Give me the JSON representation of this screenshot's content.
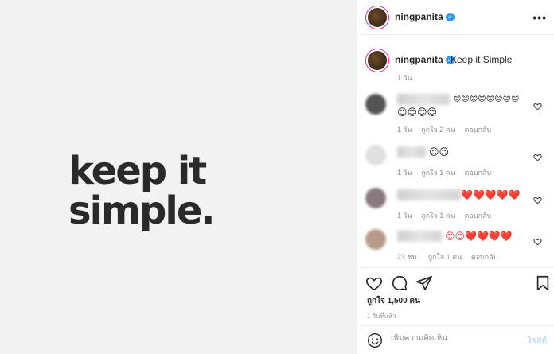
{
  "post": {
    "image_text_line1": "keep it",
    "image_text_line2": "simple."
  },
  "header": {
    "username": "ningpanita",
    "verified_icon": "verified-badge-icon",
    "more_icon": "more-options-icon"
  },
  "caption": {
    "username": "ningpanita",
    "text": "Keep it Simple",
    "time": "1 วัน"
  },
  "comments": [
    {
      "emoji_line1": "😊😊😊😊😊😊😊😊",
      "emoji_line2": "😊😊😊😍",
      "time": "1 วัน",
      "likes": "ถูกใจ 2 คน",
      "reply": "ตอบกลับ"
    },
    {
      "emoji_line1": "😍😍",
      "time": "1 วัน",
      "likes": "ถูกใจ 1 คน",
      "reply": "ตอบกลับ"
    },
    {
      "emoji_line1": "❤️❤️❤️❤️❤️",
      "time": "1 วัน",
      "likes": "ถูกใจ 1 คน",
      "reply": "ตอบกลับ"
    },
    {
      "emoji_line1": "😍😍❤️❤️❤️❤️",
      "time": "23 ชม.",
      "likes": "ถูกใจ 1 คน",
      "reply": "ตอบกลับ"
    }
  ],
  "actions": {
    "like_icon": "heart-icon",
    "comment_icon": "comment-icon",
    "share_icon": "share-icon",
    "save_icon": "bookmark-icon",
    "likes": "ถูกใจ 1,500 คน",
    "time": "1 วันที่แล้ว"
  },
  "add_comment": {
    "placeholder": "เพิ่มความคิดเห็น",
    "post_label": "โพสต์"
  },
  "colors": {
    "accent": "#3897f0",
    "muted": "#8e8e8e",
    "heart_red": "#ed4956",
    "post_disabled": "#b2dffc"
  }
}
